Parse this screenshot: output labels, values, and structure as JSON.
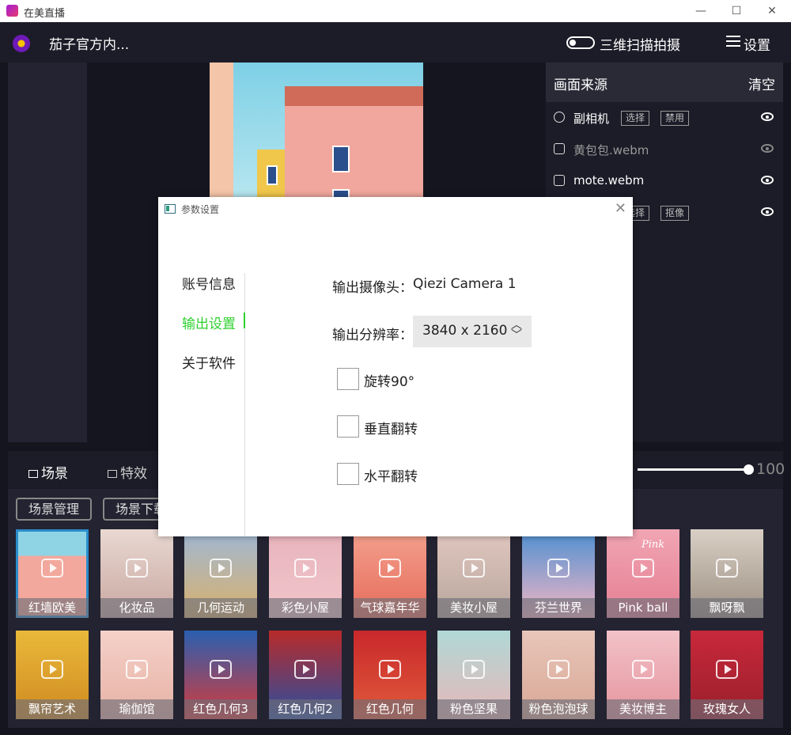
{
  "window": {
    "title": "在美直播",
    "minimize": "—",
    "maximize": "☐",
    "close": "✕"
  },
  "appbar": {
    "account_name": "茄子官方内...",
    "scan_label": "三维扫描拍摄",
    "scan_toggle_on": false,
    "settings_label": "设置"
  },
  "sources": {
    "title": "画面来源",
    "clear_label": "清空",
    "items": [
      {
        "label": "副相机",
        "icon": "camera-icon",
        "tags": [
          "选择",
          "禁用"
        ],
        "visible": true,
        "dimmed": false
      },
      {
        "label": "黄包包.webm",
        "icon": "image-icon",
        "tags": [],
        "visible": false,
        "dimmed": true
      },
      {
        "label": "mote.webm",
        "icon": "image-icon",
        "tags": [],
        "visible": true,
        "dimmed": false
      },
      {
        "label": "",
        "icon": "camera-icon",
        "tags": [
          "选择",
          "抠像"
        ],
        "visible": true,
        "dimmed": false
      }
    ]
  },
  "bottom": {
    "tabs": [
      {
        "label": "场景",
        "active": true
      },
      {
        "label": "特效",
        "active": false
      }
    ],
    "buttons": {
      "manage": "场景管理",
      "download": "场景下载"
    },
    "slider_value": 100,
    "scenes_row1": [
      "红墙欧美",
      "化妆品",
      "几何运动",
      "彩色小屋",
      "气球嘉年华",
      "美妆小屋",
      "芬兰世界",
      "Pink ball",
      "飘呀飘"
    ],
    "scenes_row2": [
      "飘帘艺术",
      "瑜伽馆",
      "红色几何3",
      "红色几何2",
      "红色几何",
      "粉色坚果",
      "粉色泡泡球",
      "美妆博主",
      "玫瑰女人"
    ],
    "selected_scene": "红墙欧美",
    "pink_ball_overlay": "Pink"
  },
  "dialog": {
    "title": "参数设置",
    "close": "✕",
    "nav": [
      {
        "label": "账号信息",
        "active": false
      },
      {
        "label": "输出设置",
        "active": true
      },
      {
        "label": "关于软件",
        "active": false
      }
    ],
    "camera_label": "输出摄像头：",
    "camera_value": "Qiezi Camera 1",
    "resolution_label": "输出分辨率：",
    "resolution_value": "3840 x 2160",
    "checkboxes": [
      {
        "label": "旋转90°",
        "checked": false
      },
      {
        "label": "垂直翻转",
        "checked": false
      },
      {
        "label": "水平翻转",
        "checked": false
      }
    ]
  },
  "colors": {
    "accent_green": "#2ed02e",
    "selection_blue": "#2a8ccc",
    "dark_bg": "#15151f"
  }
}
